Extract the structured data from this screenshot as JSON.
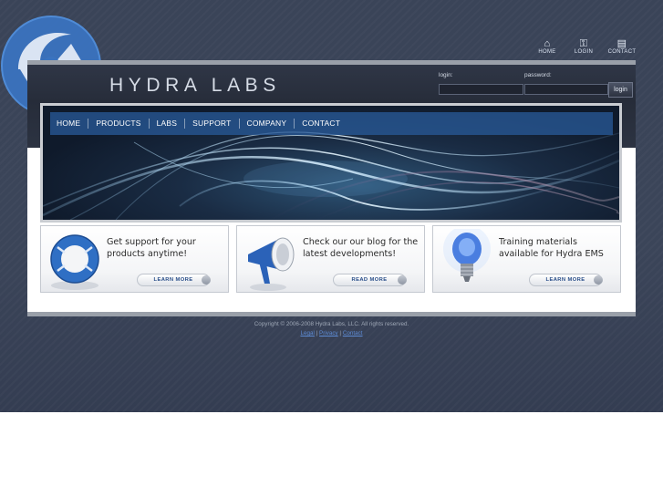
{
  "site": {
    "title": "HYDRA LABS"
  },
  "top_icons": [
    {
      "label": "HOME",
      "icon": "home-icon"
    },
    {
      "label": "LOGIN",
      "icon": "key-icon"
    },
    {
      "label": "CONTACT",
      "icon": "contact-card-icon"
    }
  ],
  "login": {
    "login_label": "login:",
    "password_label": "password:",
    "login_value": "",
    "password_value": "",
    "button_label": "login"
  },
  "nav": {
    "items": [
      "HOME",
      "PRODUCTS",
      "LABS",
      "SUPPORT",
      "COMPANY",
      "CONTACT"
    ]
  },
  "cards": [
    {
      "text": "Get support for your products anytime!",
      "button": "LEARN MORE",
      "icon": "lifebuoy-icon"
    },
    {
      "text": "Check our our blog for the latest developments!",
      "button": "READ MORE",
      "icon": "megaphone-icon"
    },
    {
      "text": "Training materials available for Hydra EMS",
      "button": "LEARN MORE",
      "icon": "lightbulb-icon"
    }
  ],
  "footer": {
    "copyright": "Copyright © 2006-2008 Hydra Labs, LLC.  All rights reserved.",
    "links": [
      "Legal",
      "Privacy",
      "Contact"
    ],
    "separator": " | "
  },
  "colors": {
    "background": "#3a4458",
    "nav_bar": "#2858a0",
    "accent_link": "#5d8bd4",
    "button_text": "#2a4f8a"
  }
}
